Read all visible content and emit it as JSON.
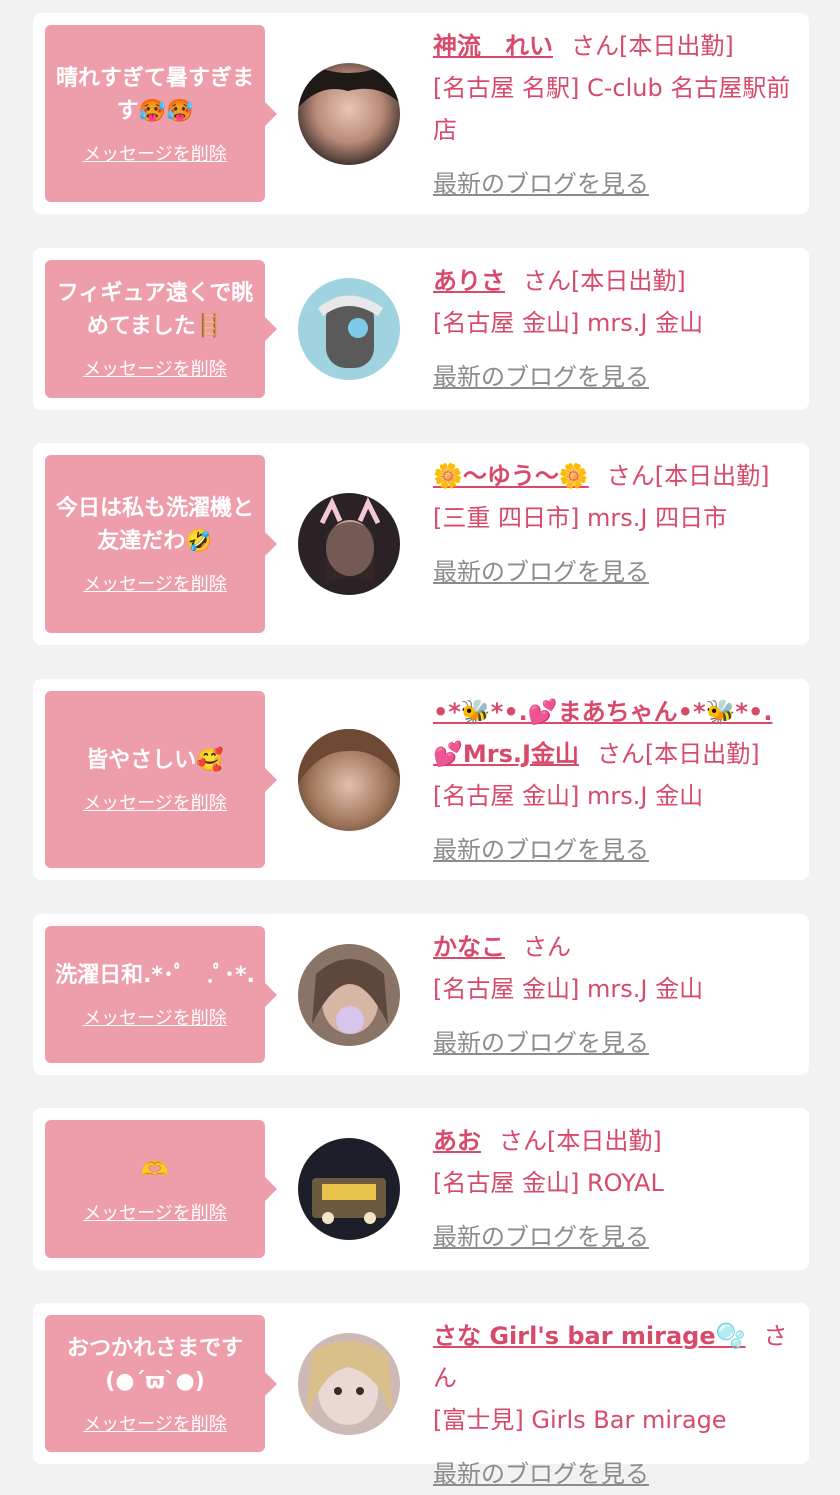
{
  "delete_label": "メッセージを削除",
  "blog_label": "最新のブログを見る",
  "colors": {
    "background": "#f2f2f2",
    "bubble": "#ee9daa",
    "accent": "#d84a6a",
    "link_gray": "#8c8c8c"
  },
  "items": [
    {
      "message": "晴れすぎて暑すぎます🥵🥵",
      "name": "神流　れい",
      "suffix": "さん[本日出勤]",
      "shop": "[名古屋 名駅] C-club 名古屋駅前店",
      "avatar_icon": "avatar-photo"
    },
    {
      "message": "フィギュア遠くで眺めてました🪜",
      "name": "ありさ",
      "suffix": "さん[本日出勤]",
      "shop": "[名古屋 金山] mrs.J 金山",
      "avatar_icon": "avatar-photo"
    },
    {
      "message": "今日は私も洗濯機と友達だわ🤣",
      "name": "🌼〜ゆう〜🌼",
      "suffix": "さん[本日出勤]",
      "shop": "[三重 四日市] mrs.J 四日市",
      "avatar_icon": "avatar-photo"
    },
    {
      "message": "皆やさしい🥰",
      "name": "•*🐝*•.💕まあちゃん•*🐝*•.💕Mrs.J金山",
      "suffix": "さん[本日出勤]",
      "shop": "[名古屋 金山] mrs.J 金山",
      "avatar_icon": "avatar-photo"
    },
    {
      "message": "洗濯日和.*･ﾟ　.ﾟ･*.",
      "name": "かなこ",
      "suffix": "さん",
      "shop": "[名古屋 金山] mrs.J 金山",
      "avatar_icon": "avatar-photo"
    },
    {
      "message": "🫶",
      "name": "あお",
      "suffix": "さん[本日出勤]",
      "shop": "[名古屋 金山] ROYAL",
      "avatar_icon": "avatar-photo"
    },
    {
      "message": "おつかれさまです(●´ϖ`●)",
      "name": "さな Girl's bar mirage🫧",
      "suffix": "さん",
      "shop": "[富士見] Girls Bar mirage",
      "avatar_icon": "avatar-photo"
    }
  ]
}
